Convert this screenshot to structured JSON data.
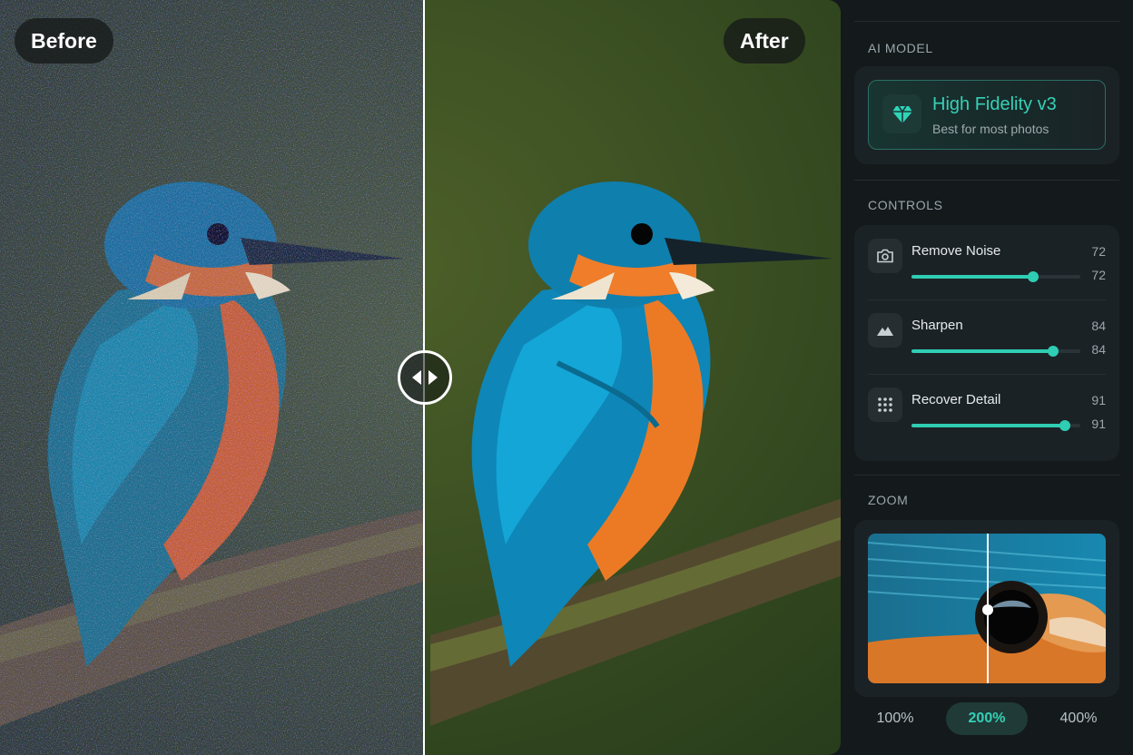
{
  "comparison": {
    "before_label": "Before",
    "after_label": "After",
    "divider_position_fraction": 0.505
  },
  "panel": {
    "ai_model": {
      "section_title": "AI MODEL",
      "name": "High Fidelity v3",
      "description": "Best for most photos",
      "icon": "diamond-icon"
    },
    "controls": {
      "section_title": "CONTROLS",
      "items": [
        {
          "label": "Remove Noise",
          "value": "72",
          "slider_value": "72",
          "level": 0.72,
          "icon": "camera-icon"
        },
        {
          "label": "Sharpen",
          "value": "84",
          "slider_value": "84",
          "level": 0.84,
          "icon": "mountain-icon"
        },
        {
          "label": "Recover Detail",
          "value": "91",
          "slider_value": "91",
          "level": 0.91,
          "icon": "grid-dots-icon"
        }
      ]
    },
    "zoom": {
      "section_title": "ZOOM",
      "options": [
        "100%",
        "200%",
        "400%"
      ],
      "selected": "200%"
    }
  },
  "colors": {
    "accent": "#2fcdb3",
    "panel_bg": "#14191c",
    "card_bg": "#1b2226"
  }
}
